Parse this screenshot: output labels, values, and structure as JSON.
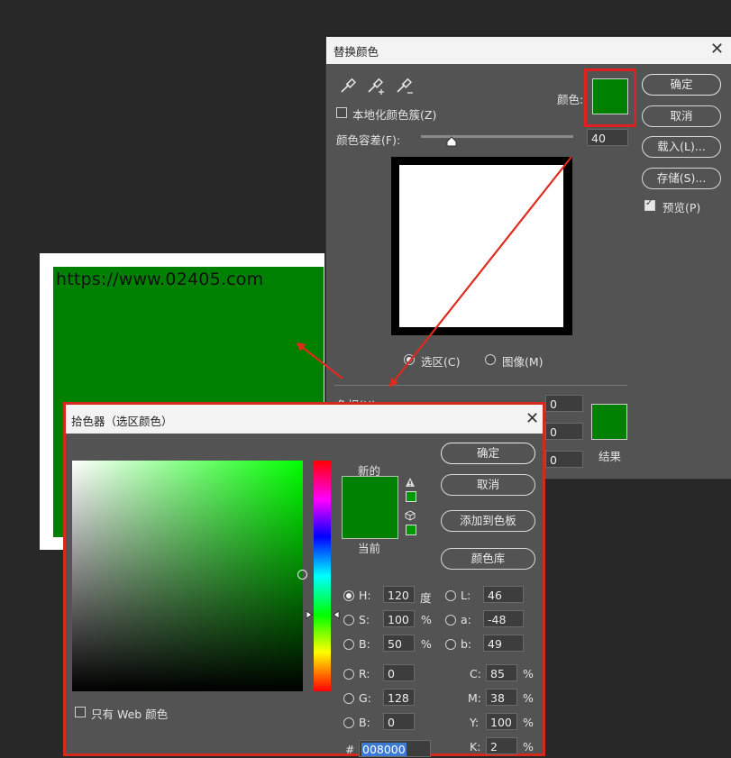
{
  "document": {
    "watermark": "https://www.02405.com",
    "fill_color": "#008000"
  },
  "replace_dialog": {
    "title": "替换颜色",
    "color_label": "颜色:",
    "localized_clusters_label": "本地化颜色簇(Z)",
    "fuzziness_label": "颜色容差(F):",
    "fuzziness_value": "40",
    "fuzziness_fraction": 0.2,
    "selection_radio": "选区(C)",
    "image_radio": "图像(M)",
    "hue_label_partial": "色相(H):",
    "hue_value": "0",
    "saturation_value": "0",
    "lightness_value": "0",
    "result_label": "结果",
    "ok_label": "确定",
    "cancel_label": "取消",
    "load_label": "载入(L)...",
    "save_label": "存储(S)...",
    "preview_label": "预览(P)",
    "preview_checked": true,
    "selected_color": "#008000",
    "result_color": "#008000",
    "eyedropper_icons": [
      "eyedropper-icon",
      "eyedropper-plus-icon",
      "eyedropper-minus-icon"
    ]
  },
  "color_picker": {
    "title": "拾色器（选区颜色）",
    "new_label": "新的",
    "current_label": "当前",
    "ok_label": "确定",
    "cancel_label": "取消",
    "add_swatch_label": "添加到色板",
    "color_libraries_label": "颜色库",
    "web_only_label": "只有 Web 颜色",
    "new_color": "#008000",
    "current_color": "#008000",
    "hsb": {
      "h_label": "H:",
      "h": "120",
      "h_unit": "度",
      "s_label": "S:",
      "s": "100",
      "s_unit": "%",
      "b_label": "B:",
      "b": "50",
      "b_unit": "%"
    },
    "lab": {
      "l_label": "L:",
      "l": "46",
      "a_label": "a:",
      "a": "-48",
      "b_label": "b:",
      "b": "49"
    },
    "rgb": {
      "r_label": "R:",
      "r": "0",
      "g_label": "G:",
      "g": "128",
      "b_label": "B:",
      "b": "0"
    },
    "cmyk": {
      "c_label": "C:",
      "c": "85",
      "m_label": "M:",
      "m": "38",
      "y_label": "Y:",
      "y": "100",
      "k_label": "K:",
      "k": "2",
      "unit": "%"
    },
    "hex_label": "#",
    "hex": "008000",
    "gamut_warning_icon": "warning-icon",
    "web_safe_icon": "cube-icon",
    "gamut_swatch_color": "#009900",
    "web_swatch_color": "#009900"
  }
}
